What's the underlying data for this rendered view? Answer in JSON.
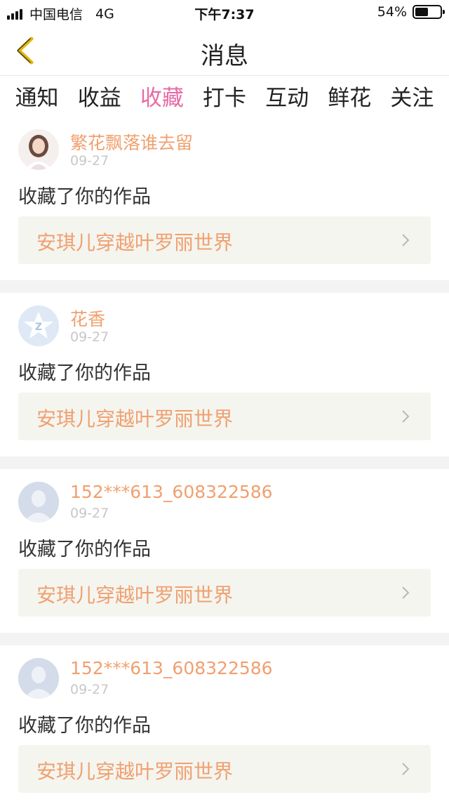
{
  "status_bar": {
    "carrier": "中国电信",
    "network": "4G",
    "time": "下午7:37",
    "battery_text": "54%",
    "battery_level": 0.54
  },
  "header": {
    "title": "消息",
    "back_icon": "chevron-left-icon"
  },
  "tabs": [
    {
      "label": "通知",
      "active": false
    },
    {
      "label": "收益",
      "active": false
    },
    {
      "label": "收藏",
      "active": true
    },
    {
      "label": "打卡",
      "active": false
    },
    {
      "label": "互动",
      "active": false
    },
    {
      "label": "鲜花",
      "active": false
    },
    {
      "label": "关注",
      "active": false
    }
  ],
  "messages": [
    {
      "name": "繁花飘落谁去留",
      "date": "09-27",
      "action": "收藏了你的作品",
      "work": "安琪儿穿越叶罗丽世界",
      "avatar": "photo-avatar"
    },
    {
      "name": "花香",
      "date": "09-27",
      "action": "收藏了你的作品",
      "work": "安琪儿穿越叶罗丽世界",
      "avatar": "qq-star-avatar"
    },
    {
      "name": "152***613_608322586",
      "date": "09-27",
      "action": "收藏了你的作品",
      "work": "安琪儿穿越叶罗丽世界",
      "avatar": "default-user-avatar"
    },
    {
      "name": "152***613_608322586",
      "date": "09-27",
      "action": "收藏了你的作品",
      "work": "安琪儿穿越叶罗丽世界",
      "avatar": "default-user-avatar"
    }
  ],
  "colors": {
    "accent_pink": "#e86aa6",
    "name_orange": "#f0a070",
    "back_yellow": "#e6b800",
    "work_bg": "#f5f5ef"
  }
}
